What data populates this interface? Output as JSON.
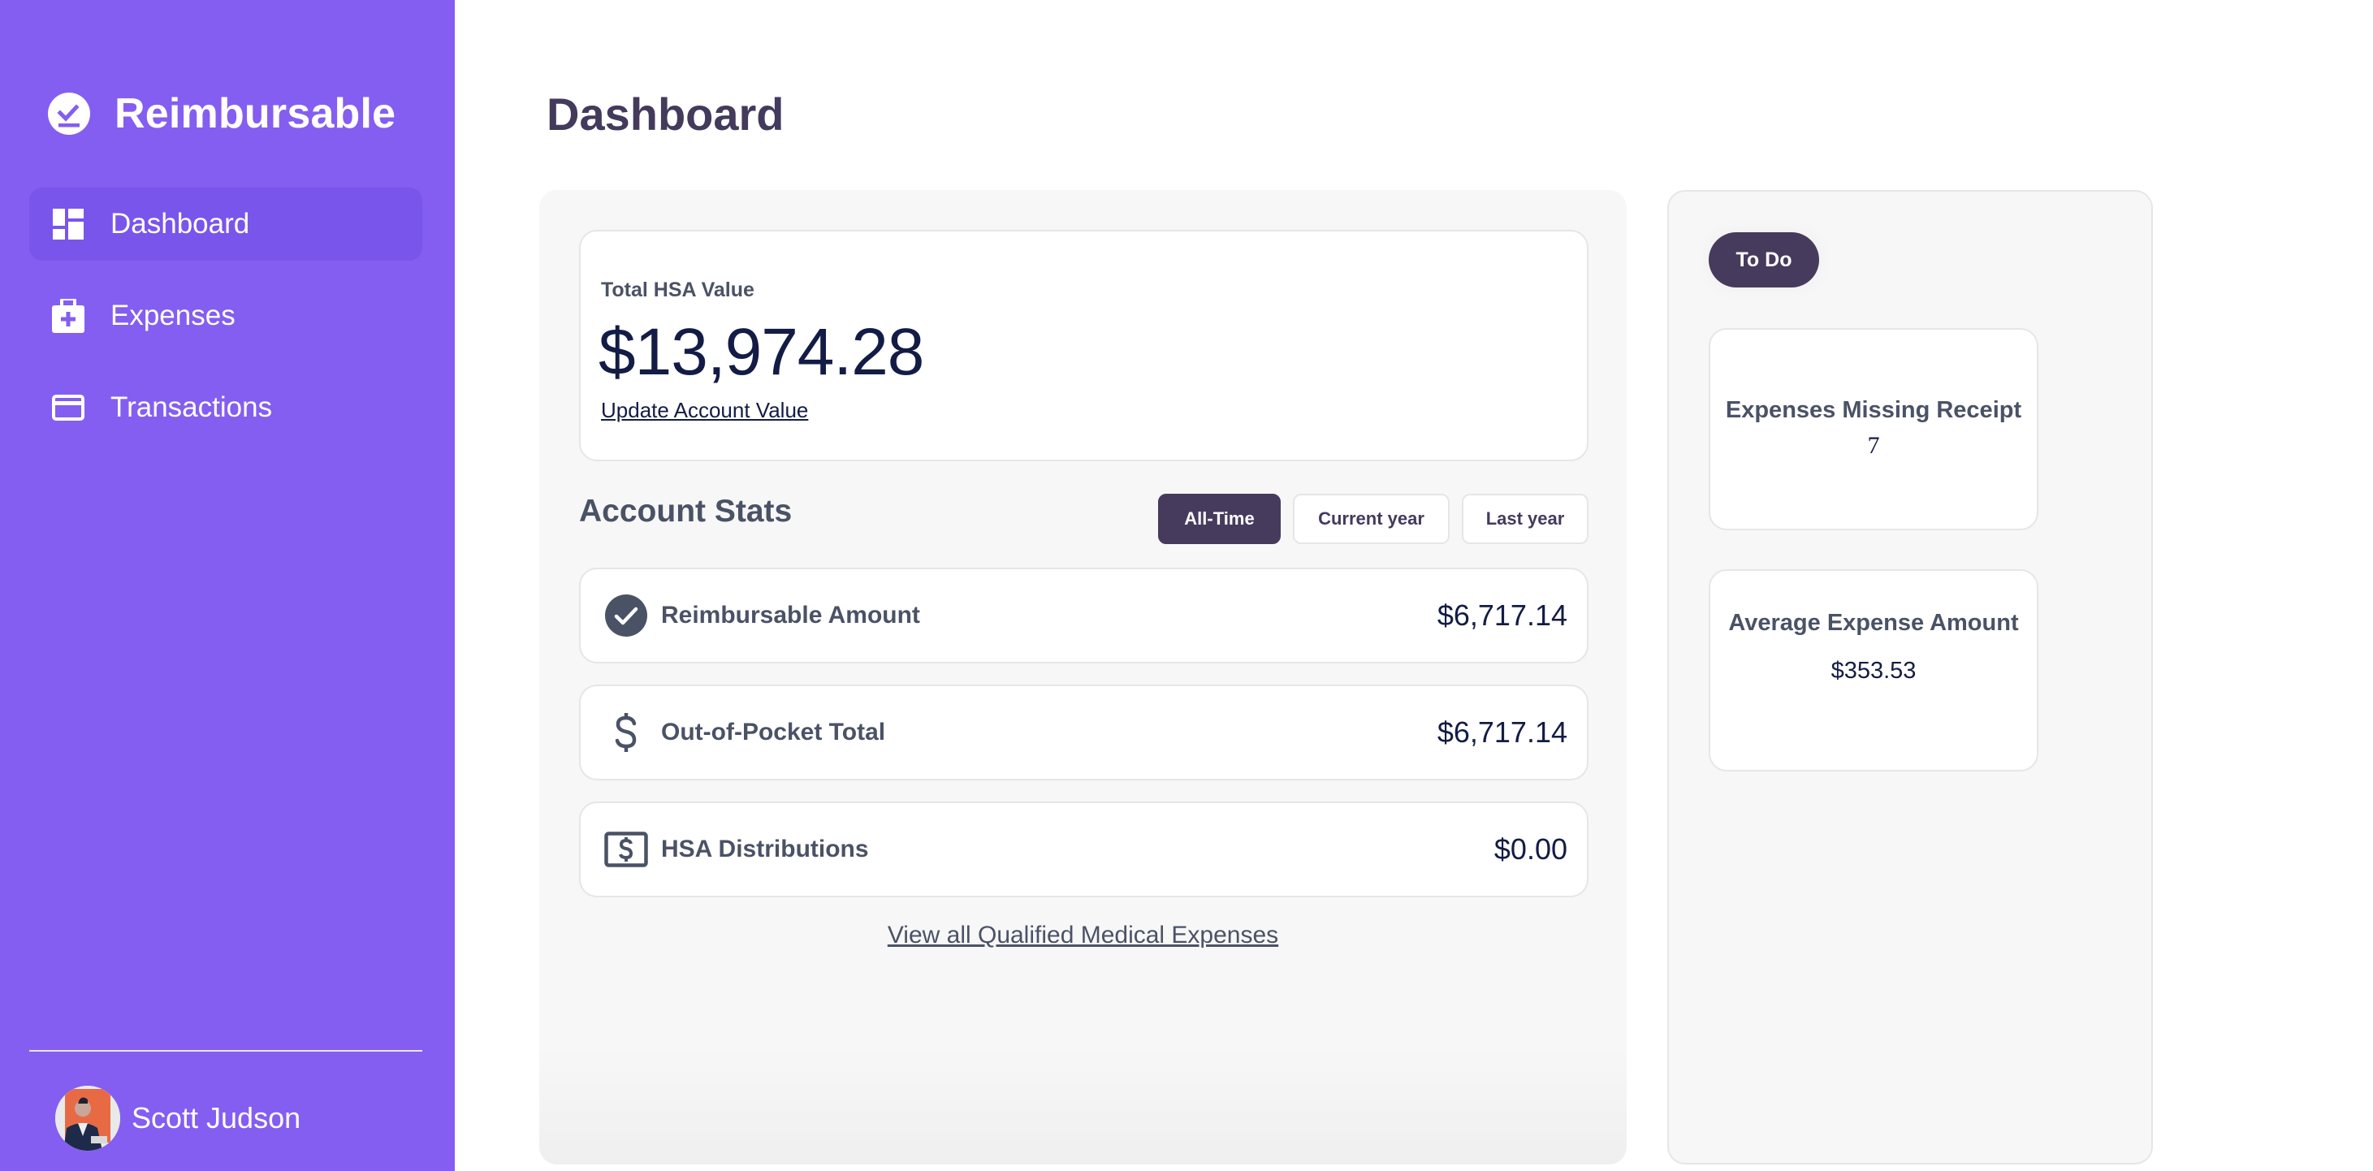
{
  "app": {
    "name": "Reimbursable",
    "logo_icon": "check-badge-icon",
    "accent_color": "#845ef0",
    "dark_color": "#463b5d"
  },
  "sidebar": {
    "items": [
      {
        "label": "Dashboard",
        "icon": "dashboard-icon",
        "active": true
      },
      {
        "label": "Expenses",
        "icon": "medical-bag-icon",
        "active": false
      },
      {
        "label": "Transactions",
        "icon": "credit-card-icon",
        "active": false
      }
    ],
    "user": {
      "name": "Scott Judson"
    }
  },
  "page": {
    "title": "Dashboard"
  },
  "hsa": {
    "label": "Total HSA Value",
    "value": "$13,974.28",
    "update_link": "Update Account Value"
  },
  "stats": {
    "title": "Account Stats",
    "filters": [
      {
        "label": "All-Time",
        "selected": true
      },
      {
        "label": "Current year",
        "selected": false
      },
      {
        "label": "Last year",
        "selected": false
      }
    ],
    "rows": [
      {
        "label": "Reimbursable Amount",
        "value": "$6,717.14",
        "icon": "check-circle-icon"
      },
      {
        "label": "Out-of-Pocket Total",
        "value": "$6,717.14",
        "icon": "dollar-icon"
      },
      {
        "label": "HSA Distributions",
        "value": "$0.00",
        "icon": "dollar-box-icon"
      }
    ],
    "view_all_link": "View all Qualified Medical Expenses"
  },
  "todo": {
    "pill_label": "To Do",
    "cards": [
      {
        "title": "Expenses Missing Receipt",
        "value": "7"
      },
      {
        "title": "Average Expense Amount",
        "value": "$353.53"
      }
    ]
  }
}
